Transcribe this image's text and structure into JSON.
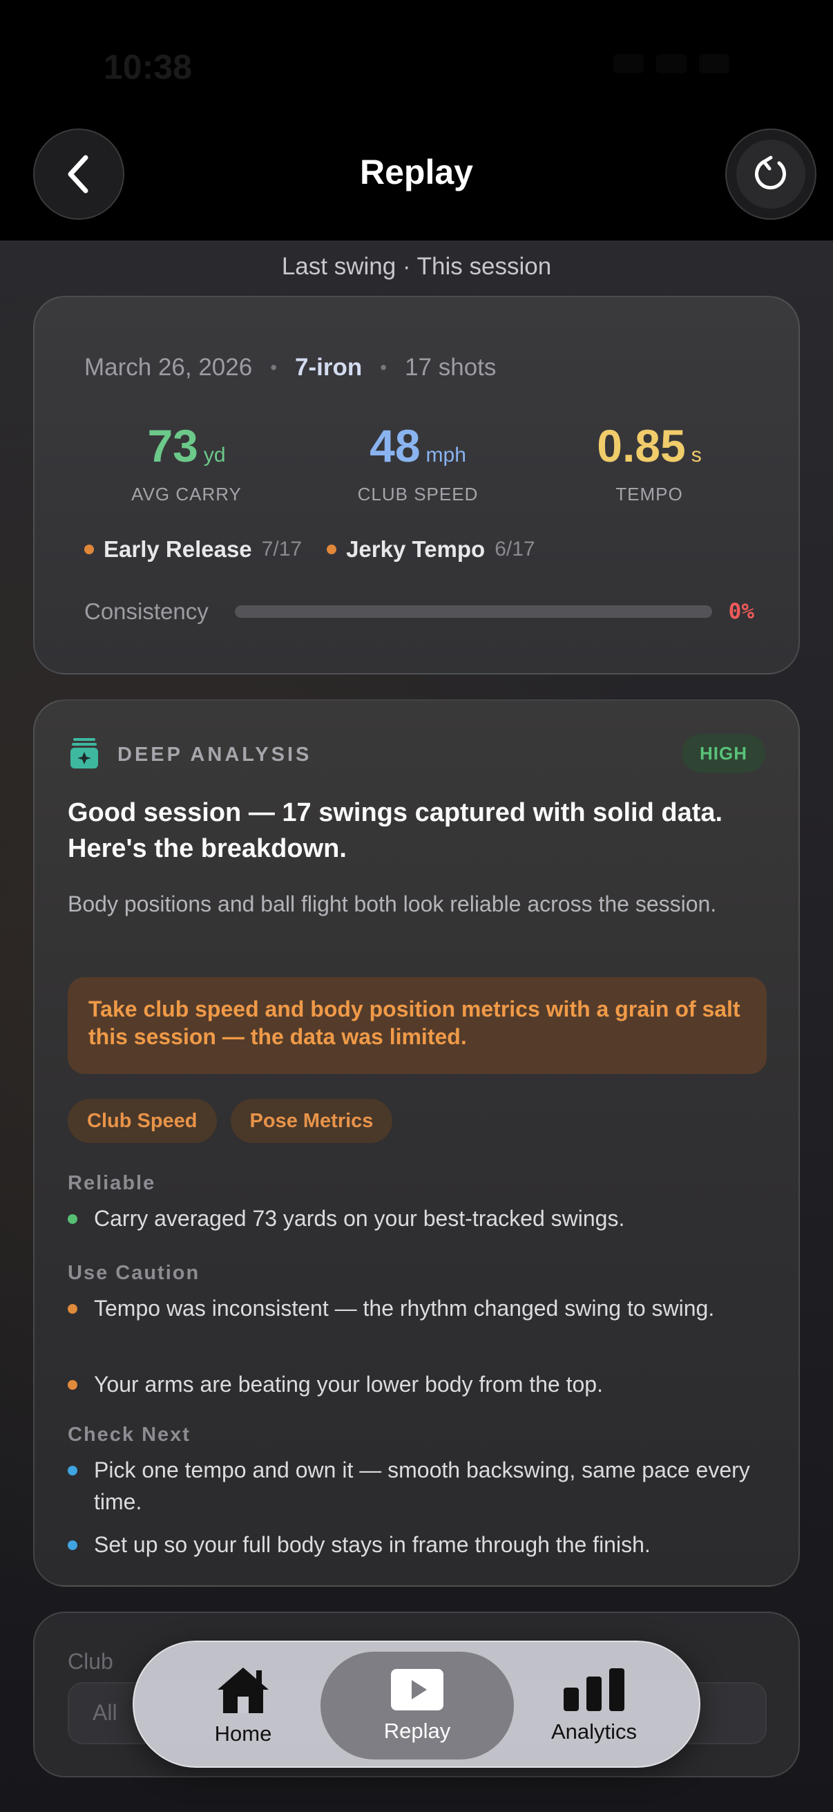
{
  "status_bar": {
    "time": "10:38"
  },
  "header": {
    "title": "Replay"
  },
  "subtitle": "Last swing · This session",
  "summary": {
    "date": "March 26, 2026",
    "club": "7-iron",
    "shots": "17 shots",
    "stats": [
      {
        "value": "73",
        "unit": "yd",
        "label": "AVG CARRY"
      },
      {
        "value": "48",
        "unit": "mph",
        "label": "CLUB SPEED"
      },
      {
        "value": "0.85",
        "unit": "s",
        "label": "TEMPO"
      }
    ],
    "faults": [
      {
        "name": "Early Release",
        "count": "7/17"
      },
      {
        "name": "Jerky Tempo",
        "count": "6/17"
      }
    ],
    "consistency": {
      "label": "Consistency",
      "value_text": "0%",
      "value": 0
    }
  },
  "analysis": {
    "title": "DEEP ANALYSIS",
    "badge": "HIGH",
    "headline": "Good session — 17 swings captured with solid data. Here's the breakdown.",
    "body": "Body positions and ball flight both look reliable across the session.",
    "warning": "Take club speed and body position metrics with a grain of salt this session — the data was limited.",
    "chips": [
      "Club Speed",
      "Pose Metrics"
    ],
    "sections": {
      "reliable": {
        "title": "Reliable",
        "items": [
          "Carry averaged 73 yards on your best-tracked swings."
        ]
      },
      "caution": {
        "title": "Use Caution",
        "items": [
          "Tempo was inconsistent — the rhythm changed swing to swing.",
          "Your arms are beating your lower body from the top."
        ]
      },
      "next": {
        "title": "Check Next",
        "items": [
          "Pick one tempo and own it — smooth backswing, same pace every time.",
          "Set up so your full body stays in frame through the finish."
        ]
      }
    },
    "colors": {
      "reliable": "#57bf74",
      "caution": "#e08a3c",
      "next": "#3fa4e0",
      "badge": "#59c279"
    }
  },
  "filter": {
    "label": "Club",
    "value": "All"
  },
  "tabbar": {
    "tabs": [
      {
        "label": "Home",
        "icon": "home-icon"
      },
      {
        "label": "Replay",
        "icon": "play-icon",
        "active": true
      },
      {
        "label": "Analytics",
        "icon": "bar-chart-icon"
      }
    ]
  }
}
